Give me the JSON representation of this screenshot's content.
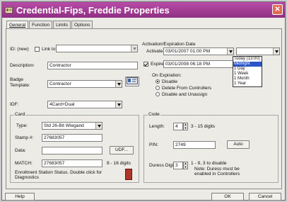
{
  "window": {
    "title": "Credential-Fips, Freddie Properties",
    "close_label": "✕"
  },
  "tabs": [
    "General",
    "Function",
    "Limits",
    "Options"
  ],
  "general": {
    "id_label": "ID: (new)",
    "link_to_label": "Link to:",
    "link_to_value": "",
    "description_label": "Description:",
    "description_value": "Contractor",
    "badge_template_label": "Badge Template:",
    "badge_template_value": "Contractor",
    "idf_label": "IDF:",
    "idf_value": "4Card+Dual"
  },
  "activation": {
    "group_title": "Activation/Expiration Date",
    "activate_label": "Activate:",
    "activate_value": "03/01/2007 01:00 PM",
    "expires_label": "Expire:",
    "expires_value": "03/01/2008 06:18 PM",
    "expires_checked": true,
    "duration_value": "",
    "duration_options": [
      "Today (13:00)",
      "Midnight",
      "1 Day",
      "1 Week",
      "1 Month",
      "1 Year"
    ],
    "duration_selected_index": 1,
    "on_expiration_label": "On Expiration:",
    "expiration_options": [
      "Disable",
      "Delete From Controllers",
      "Disable and Unassign"
    ],
    "expiration_selected_index": 0
  },
  "card": {
    "group_title": "Card",
    "type_label": "Type:",
    "type_value": "Std 26-Bit Wiegand",
    "stamp_label": "Stamp #:",
    "stamp_value": "27683057",
    "data_label": "Data:",
    "data_value": "",
    "udf_button": "UDF...",
    "match_label": "MATCH:",
    "match_value": "27683057",
    "match_hint": "8 - 16 digits",
    "enrollment_text": "Enrollment Station Status. Double click for Diagnostics"
  },
  "code": {
    "group_title": "Code",
    "length_label": "Length:",
    "length_value": "4",
    "length_hint": "3 - 15 digits",
    "pin_label": "PIN:",
    "pin_value": "2749",
    "auto_button": "Auto",
    "duress_label": "Duress Digit:",
    "duress_value": "3",
    "duress_hint": "1 - 9, 3 to disable",
    "duress_note": "Note: Duress must be enabled in Controllers"
  },
  "footer": {
    "help_button": "Help",
    "ok_button": "OK",
    "cancel_button": "Cancel"
  },
  "colors": {
    "titlebar": "#a53d97",
    "selection": "#2a56c6",
    "close": "#e06a52"
  }
}
